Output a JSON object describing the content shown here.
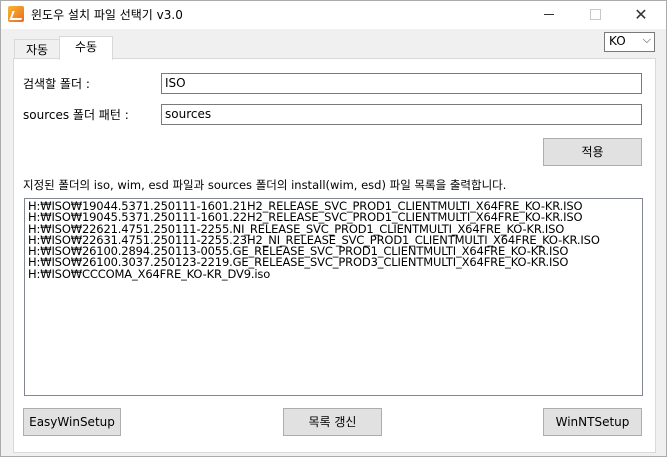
{
  "window": {
    "title": "윈도우 설치 파일 선택기 v3.0",
    "controls": {
      "minimize": "—",
      "maximize": "",
      "close": "✕"
    }
  },
  "tabs": [
    {
      "label": "자동",
      "active": false
    },
    {
      "label": "수동",
      "active": true
    }
  ],
  "language": {
    "selected": "KO"
  },
  "form": {
    "search_folder_label": "검색할 폴더 :",
    "search_folder_value": "ISO",
    "sources_pattern_label": "sources 폴더 패턴 :",
    "sources_pattern_value": "sources",
    "apply_button": "적용"
  },
  "description": "지정된 폴더의 iso, wim, esd 파일과 sources 폴더의 install(wim, esd) 파일 목록을 출력합니다.",
  "file_list": [
    "H:₩ISO₩19044.5371.250111-1601.21H2_RELEASE_SVC_PROD1_CLIENTMULTI_X64FRE_KO-KR.ISO",
    "H:₩ISO₩19045.5371.250111-1601.22H2_RELEASE_SVC_PROD1_CLIENTMULTI_X64FRE_KO-KR.ISO",
    "H:₩ISO₩22621.4751.250111-2255.NI_RELEASE_SVC_PROD1_CLIENTMULTI_X64FRE_KO-KR.ISO",
    "H:₩ISO₩22631.4751.250111-2255.23H2_NI_RELEASE_SVC_PROD1_CLIENTMULTI_X64FRE_KO-KR.ISO",
    "H:₩ISO₩26100.2894.250113-0055.GE_RELEASE_SVC_PROD1_CLIENTMULTI_X64FRE_KO-KR.ISO",
    "H:₩ISO₩26100.3037.250123-2219.GE_RELEASE_SVC_PROD3_CLIENTMULTI_X64FRE_KO-KR.ISO",
    "H:₩ISO₩CCCOMA_X64FRE_KO-KR_DV9.iso"
  ],
  "buttons": {
    "easywinsetup": "EasyWinSetup",
    "refresh": "목록 갱신",
    "winntsetup": "WinNTSetup"
  },
  "colors": {
    "window_bg": "#f0f0f0",
    "panel_bg": "#ffffff",
    "button_bg": "#e1e1e1",
    "button_border": "#adadad"
  }
}
